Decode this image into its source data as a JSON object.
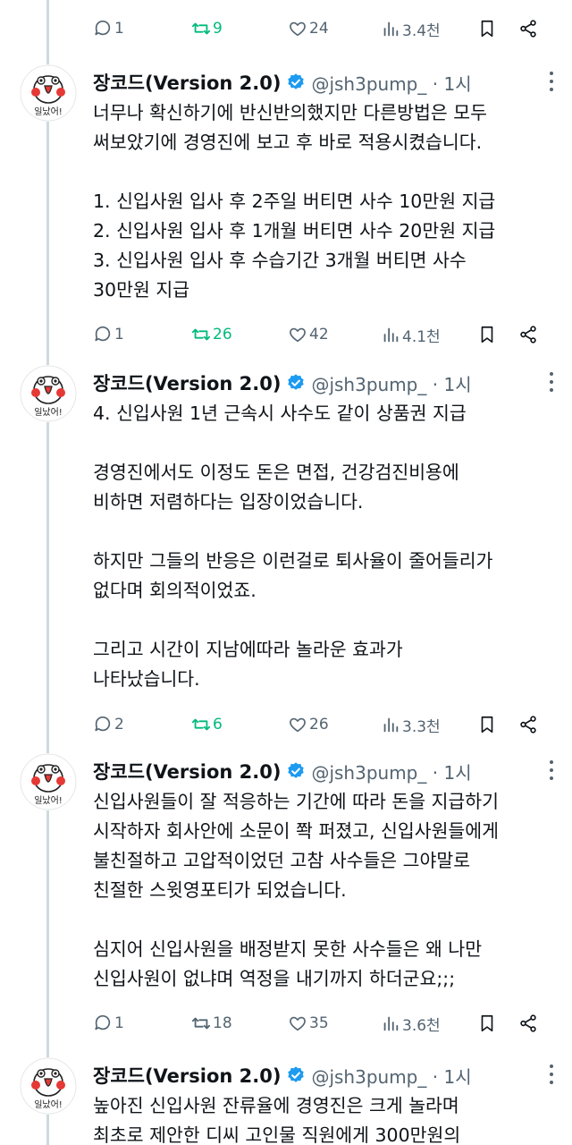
{
  "author": {
    "name": "장코드(Version 2.0)",
    "handle": "@jsh3pump_",
    "time": "1시",
    "avatar_text": "일났어!"
  },
  "top_action_bar": {
    "replies": "1",
    "retweets": "9",
    "likes": "24",
    "views": "3.4천"
  },
  "tweets": [
    {
      "lines": [
        "너무나 확신하기에 반신반의했지만 다른방법은 모두",
        "써보았기에 경영진에 보고 후 바로 적용시켰습니다.",
        "",
        "1. 신입사원 입사 후 2주일 버티면 사수 10만원 지급",
        "2. 신입사원 입사 후 1개월 버티면 사수 20만원 지급",
        "3. 신입사원 입사 후 수습기간 3개월 버티면 사수",
        "30만원 지급"
      ],
      "replies": "1",
      "retweets": "26",
      "likes": "42",
      "views": "4.1천"
    },
    {
      "lines": [
        "4. 신입사원 1년 근속시 사수도 같이 상품권 지급",
        "",
        "경영진에서도 이정도 돈은 면접, 건강검진비용에",
        "비하면 저렴하다는 입장이었습니다.",
        "",
        "하지만 그들의 반응은 이런걸로 퇴사율이 줄어들리가",
        "없다며 회의적이었죠.",
        "",
        "그리고 시간이 지남에따라 놀라운 효과가",
        "나타났습니다."
      ],
      "replies": "2",
      "retweets": "6",
      "likes": "26",
      "views": "3.3천"
    },
    {
      "lines": [
        "신입사원들이 잘 적응하는 기간에 따라 돈을 지급하기",
        "시작하자 회사안에 소문이 쫙 퍼졌고, 신입사원들에게",
        "불친절하고 고압적이었던 고참 사수들은 그야말로",
        "친절한 스윗영포티가 되었습니다.",
        "",
        "심지어 신입사원을 배정받지 못한 사수들은 왜 나만",
        "신입사원이 없냐며 역정을 내기까지 하더군요;;;"
      ],
      "replies": "1",
      "retweets": "18",
      "likes": "35",
      "views": "3.6천"
    },
    {
      "lines": [
        "높아진 신입사원 잔류율에 경영진은 크게 놀라며",
        "최초로 제안한 디씨 고인물 직원에게 300만원의"
      ]
    }
  ],
  "colors": {
    "text": "#0f1419",
    "muted": "#536471",
    "retweet_green": "#00ba7c",
    "verified_blue": "#1d9bf0",
    "thread_line": "#cfd9de"
  }
}
